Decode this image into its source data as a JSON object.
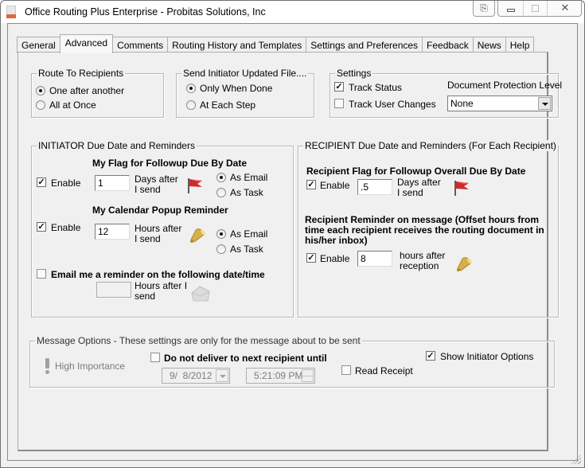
{
  "window": {
    "title": "Office Routing Plus Enterprise - Probitas Solutions, Inc",
    "buttons": {
      "extra": "⎘",
      "close": "✕"
    }
  },
  "tabs": [
    {
      "label": "General",
      "active": false
    },
    {
      "label": "Advanced",
      "active": true
    },
    {
      "label": "Comments",
      "active": false
    },
    {
      "label": "Routing History and Templates",
      "active": false
    },
    {
      "label": "Settings and Preferences",
      "active": false
    },
    {
      "label": "Feedback",
      "active": false
    },
    {
      "label": "News",
      "active": false
    },
    {
      "label": "Help",
      "active": false
    }
  ],
  "route_to_recipients": {
    "label": "Route To Recipients",
    "options": [
      "One after another",
      "All at Once"
    ],
    "selected": "One after another"
  },
  "send_initiator": {
    "label": "Send Initiator Updated File....",
    "options": [
      "Only When Done",
      "At Each Step"
    ],
    "selected": "Only When Done"
  },
  "settings": {
    "label": "Settings",
    "track_status": {
      "label": "Track Status",
      "checked": true
    },
    "track_user_changes": {
      "label": "Track User Changes",
      "checked": false
    },
    "protection_label": "Document Protection Level",
    "protection_value": "None"
  },
  "initiator": {
    "label": "INITIATOR Due Date and Reminders",
    "flag": {
      "heading": "My Flag for Followup Due By Date",
      "enable_label": "Enable",
      "enabled": true,
      "value": "1",
      "unit_line1": "Days after",
      "unit_line2": "I send",
      "options": [
        "As Email",
        "As Task"
      ],
      "selected": "As Email"
    },
    "popup": {
      "heading": "My Calendar Popup Reminder",
      "enable_label": "Enable",
      "enabled": true,
      "value": "12",
      "unit_line1": "Hours after",
      "unit_line2": "I send",
      "options": [
        "As Email",
        "As Task"
      ],
      "selected": "As Email"
    },
    "email_reminder": {
      "label": "Email me a reminder on the following date/time",
      "checked": false,
      "value": "",
      "unit_line1": "Hours after I",
      "unit_line2": "send"
    }
  },
  "recipient": {
    "label": "RECIPIENT Due Date and Reminders  (For Each Recipient)",
    "flag": {
      "heading": "Recipient Flag for Followup Overall Due By Date",
      "enable_label": "Enable",
      "enabled": true,
      "value": ".5",
      "unit_line1": "Days after",
      "unit_line2": "I send"
    },
    "reminder": {
      "heading_line1": "Recipient Reminder on message (Offset hours from",
      "heading_line2": "time each recipient receives the routing document in",
      "heading_line3": "his/her inbox)",
      "enable_label": "Enable",
      "enabled": true,
      "value": "8",
      "unit_line1": "hours after",
      "unit_line2": "reception"
    }
  },
  "message_options": {
    "label": "Message Options - These settings are only for the message about to be sent",
    "high_importance": "High Importance",
    "do_not_deliver": {
      "label": "Do not deliver to next recipient until",
      "checked": false
    },
    "date_value": "9/  8/2012",
    "time_value": "5:21:09 PM",
    "read_receipt": {
      "label": "Read Receipt",
      "checked": false
    },
    "show_initiator": {
      "label": "Show Initiator Options",
      "checked": true
    }
  }
}
